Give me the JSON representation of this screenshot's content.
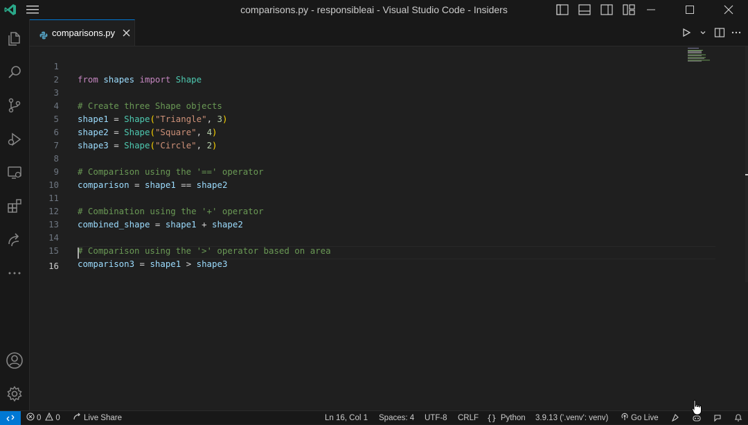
{
  "window": {
    "title": "comparisons.py - responsibleai - Visual Studio Code - Insiders"
  },
  "colors": {
    "accent": "#0078d4",
    "background": "#1f1f1f",
    "chrome": "#181818"
  },
  "activity_bar": {
    "items": [
      "explorer-icon",
      "search-icon",
      "source-control-icon",
      "run-debug-icon",
      "remote-explorer-icon",
      "extensions-icon",
      "live-share-icon",
      "more-icon"
    ],
    "bottom": [
      "accounts-icon",
      "manage-gear-icon"
    ]
  },
  "tab": {
    "name": "comparisons.py",
    "close_glyph": "✕"
  },
  "code": {
    "lines": [
      {
        "n": "1"
      },
      {
        "n": "2"
      },
      {
        "n": "3"
      },
      {
        "n": "4"
      },
      {
        "n": "5"
      },
      {
        "n": "6"
      },
      {
        "n": "7"
      },
      {
        "n": "8"
      },
      {
        "n": "9"
      },
      {
        "n": "10"
      },
      {
        "n": "11"
      },
      {
        "n": "12"
      },
      {
        "n": "13"
      },
      {
        "n": "14"
      },
      {
        "n": "15"
      },
      {
        "n": "16"
      }
    ],
    "l1": {
      "a": "from",
      "b": "shapes",
      "c": "import",
      "d": "Shape"
    },
    "l3": "# Create three Shape objects",
    "l4": {
      "var": "shape1",
      "fn": "Shape",
      "str": "\"Triangle\"",
      "num": "3"
    },
    "l5": {
      "var": "shape2",
      "fn": "Shape",
      "str": "\"Square\"",
      "num": "4"
    },
    "l6": {
      "var": "shape3",
      "fn": "Shape",
      "str": "\"Circle\"",
      "num": "2"
    },
    "l8": "# Comparison using the '==' operator",
    "l9": {
      "var": "comparison",
      "a": "shape1",
      "op": "==",
      "b": "shape2"
    },
    "l11": "# Combination using the '+' operator",
    "l12": {
      "var": "combined_shape",
      "a": "shape1",
      "op": "+",
      "b": "shape2"
    },
    "l14": "# Comparison using the '>' operator based on area",
    "l15": {
      "var": "comparison3",
      "a": "shape1",
      "op": ">",
      "b": "shape3"
    }
  },
  "status": {
    "errors": "0",
    "warnings": "0",
    "live_share": "Live Share",
    "position": "Ln 16, Col 1",
    "spaces": "Spaces: 4",
    "encoding": "UTF-8",
    "eol": "CRLF",
    "language": "Python",
    "interpreter": "3.9.13 ('.venv': venv)",
    "go_live": "Go Live"
  }
}
